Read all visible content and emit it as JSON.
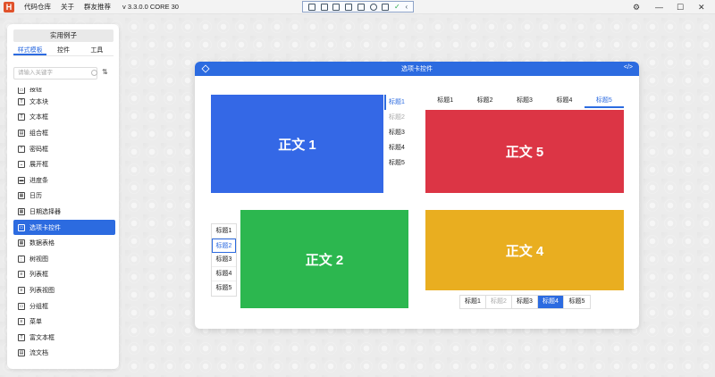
{
  "titlebar": {
    "logo": "H",
    "menu": [
      "代码仓库",
      "关于",
      "群友推荐"
    ],
    "version": "v 3.3.0.0 CORE 30",
    "controls": {
      "settings": "⚙",
      "minimize": "—",
      "maximize": "☐",
      "close": "✕"
    }
  },
  "sidebar": {
    "examples_label": "实用例子",
    "tabs": [
      "样式模板",
      "控件",
      "工具"
    ],
    "active_tab": 0,
    "search_placeholder": "请输入关键字",
    "items": [
      {
        "label": "按钮",
        "icon": "button-icon",
        "glyph": "▭"
      },
      {
        "label": "文本块",
        "icon": "text-block-icon",
        "glyph": "T"
      },
      {
        "label": "文本框",
        "icon": "text-box-icon",
        "glyph": "T"
      },
      {
        "label": "组合框",
        "icon": "combo-box-icon",
        "glyph": "▤"
      },
      {
        "label": "密码框",
        "icon": "password-box-icon",
        "glyph": "*"
      },
      {
        "label": "展开框",
        "icon": "expander-icon",
        "glyph": "⌄"
      },
      {
        "label": "进度条",
        "icon": "progress-bar-icon",
        "glyph": "▬"
      },
      {
        "label": "日历",
        "icon": "calendar-icon",
        "glyph": "▦"
      },
      {
        "label": "日期选择器",
        "icon": "date-picker-icon",
        "glyph": "▦"
      },
      {
        "label": "选项卡控件",
        "icon": "tab-control-icon",
        "glyph": "▭",
        "active": true
      },
      {
        "label": "数据表格",
        "icon": "data-grid-icon",
        "glyph": "▦"
      },
      {
        "label": "树视图",
        "icon": "tree-view-icon",
        "glyph": "⋮"
      },
      {
        "label": "列表框",
        "icon": "list-box-icon",
        "glyph": "≡"
      },
      {
        "label": "列表视图",
        "icon": "list-view-icon",
        "glyph": "≡"
      },
      {
        "label": "分组框",
        "icon": "group-box-icon",
        "glyph": "▭"
      },
      {
        "label": "菜单",
        "icon": "menu-icon",
        "glyph": "≡"
      },
      {
        "label": "富文本框",
        "icon": "rich-text-box-icon",
        "glyph": "T"
      },
      {
        "label": "流文档",
        "icon": "flow-document-icon",
        "glyph": "▤"
      }
    ]
  },
  "demo": {
    "title": "选项卡控件",
    "code_icon": "</>",
    "tabs": [
      "标题1",
      "标题2",
      "标题3",
      "标题4",
      "标题5"
    ],
    "right_tabs": {
      "active": 0,
      "disabled": [
        1
      ],
      "content": "正文 1",
      "color": "#3468e6"
    },
    "top_tabs": {
      "active": 4,
      "disabled": [],
      "content": "正文 5",
      "color": "#dc3545"
    },
    "left_tabs": {
      "active": 1,
      "disabled": [],
      "content": "正文 2",
      "color": "#2cb74f"
    },
    "bottom_tabs": {
      "active": 3,
      "disabled": [
        1
      ],
      "content": "正文 4",
      "color": "#e9ae20"
    }
  }
}
